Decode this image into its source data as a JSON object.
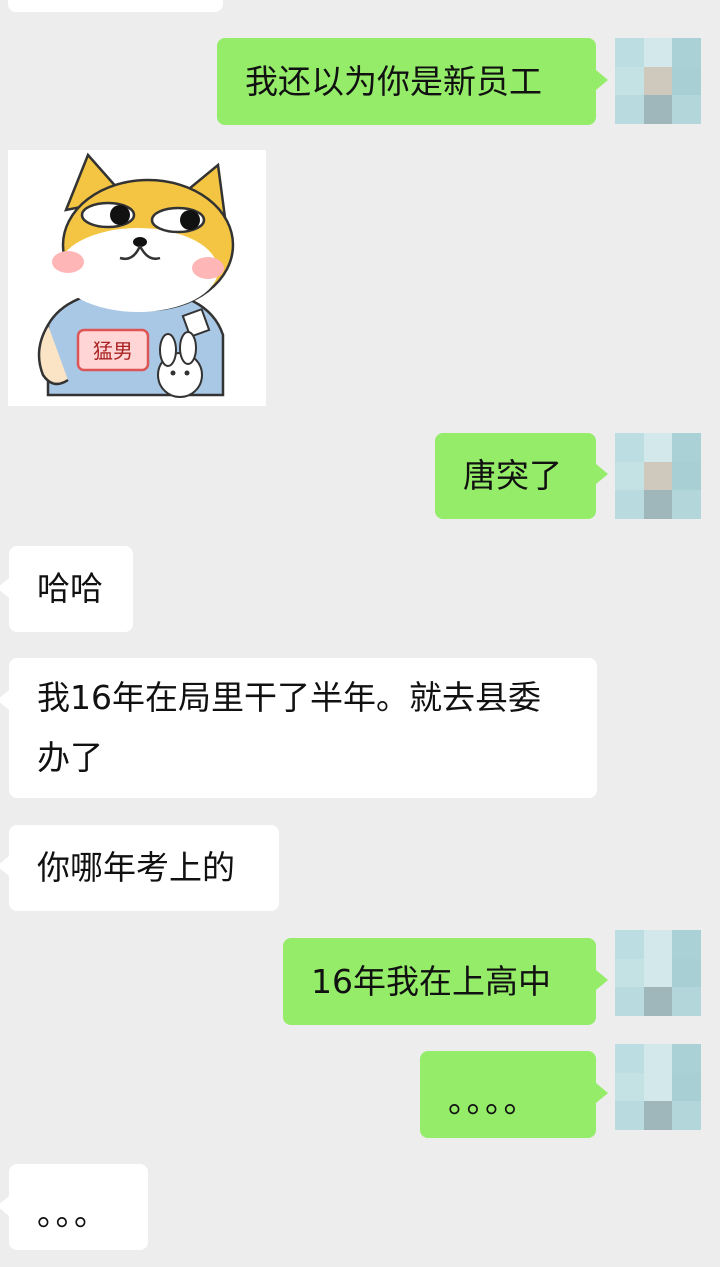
{
  "messages": {
    "m1": "我还以为你是新员工",
    "m2": "唐突了",
    "m3": "哈哈",
    "m4": "我16年在局里干了半年。就去县委办了",
    "m5": "你哪年考上的",
    "m6": "16年我在上高中",
    "m7": "。。。。",
    "m8": "。。。"
  },
  "sticker": {
    "badge": "猛男",
    "icon": "shiba-sticker"
  },
  "colors": {
    "background": "#ededed",
    "self_bubble": "#95ec69",
    "other_bubble": "#ffffff"
  }
}
